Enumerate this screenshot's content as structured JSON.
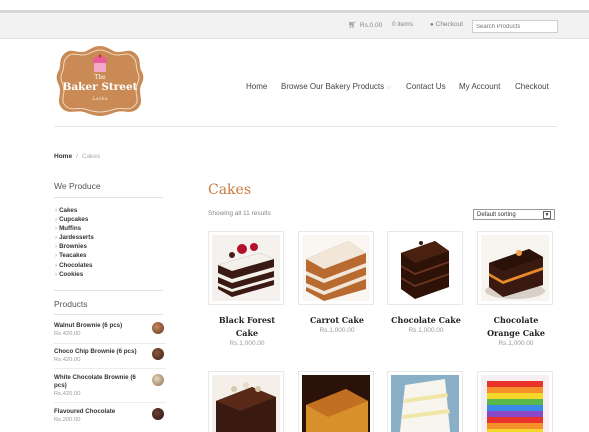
{
  "topbar": {
    "cart_total": "Rs.0.00",
    "cart_items": "0 items",
    "checkout_label": "Checkout",
    "search_placeholder": "Search Products"
  },
  "logo": {
    "line1": "The",
    "line2": "Baker Street",
    "line3": "Lanka"
  },
  "nav": {
    "home": "Home",
    "browse": "Browse Our Bakery Products",
    "contact": "Contact Us",
    "account": "My Account",
    "checkout": "Checkout"
  },
  "breadcrumb": {
    "home": "Home",
    "sep": "/",
    "current": "Cakes"
  },
  "sidebar": {
    "produce_title": "We Produce",
    "categories": [
      "Cakes",
      "Cupcakes",
      "Muffins",
      "Jardesserts",
      "Brownies",
      "Teacakes",
      "Chocolates",
      "Cookies"
    ],
    "products_title": "Products",
    "products": [
      {
        "name": "Walnut Brownie (6 pcs)",
        "price": "Rs.420.00"
      },
      {
        "name": "Choco Chip Brownie (6 pcs)",
        "price": "Rs.420.00"
      },
      {
        "name": "White Chocolate Brownie (6 pcs)",
        "price": "Rs.420.00"
      },
      {
        "name": "Flavoured Chocolate",
        "price": "Rs.200.00"
      }
    ]
  },
  "main": {
    "title": "Cakes",
    "showing": "Showing all 11 results",
    "sort": "Default sorting",
    "products": [
      {
        "name": "Black Forest Cake",
        "price": "Rs.1,000.00"
      },
      {
        "name": "Carrot Cake",
        "price": "Rs.1,000.00"
      },
      {
        "name": "Chocolate Cake",
        "price": "Rs.1,000.00"
      },
      {
        "name": "Chocolate Orange Cake",
        "price": "Rs.1,000.00"
      }
    ]
  },
  "colors": {
    "accent": "#c8773f",
    "logo_bg": "#c98a55"
  }
}
